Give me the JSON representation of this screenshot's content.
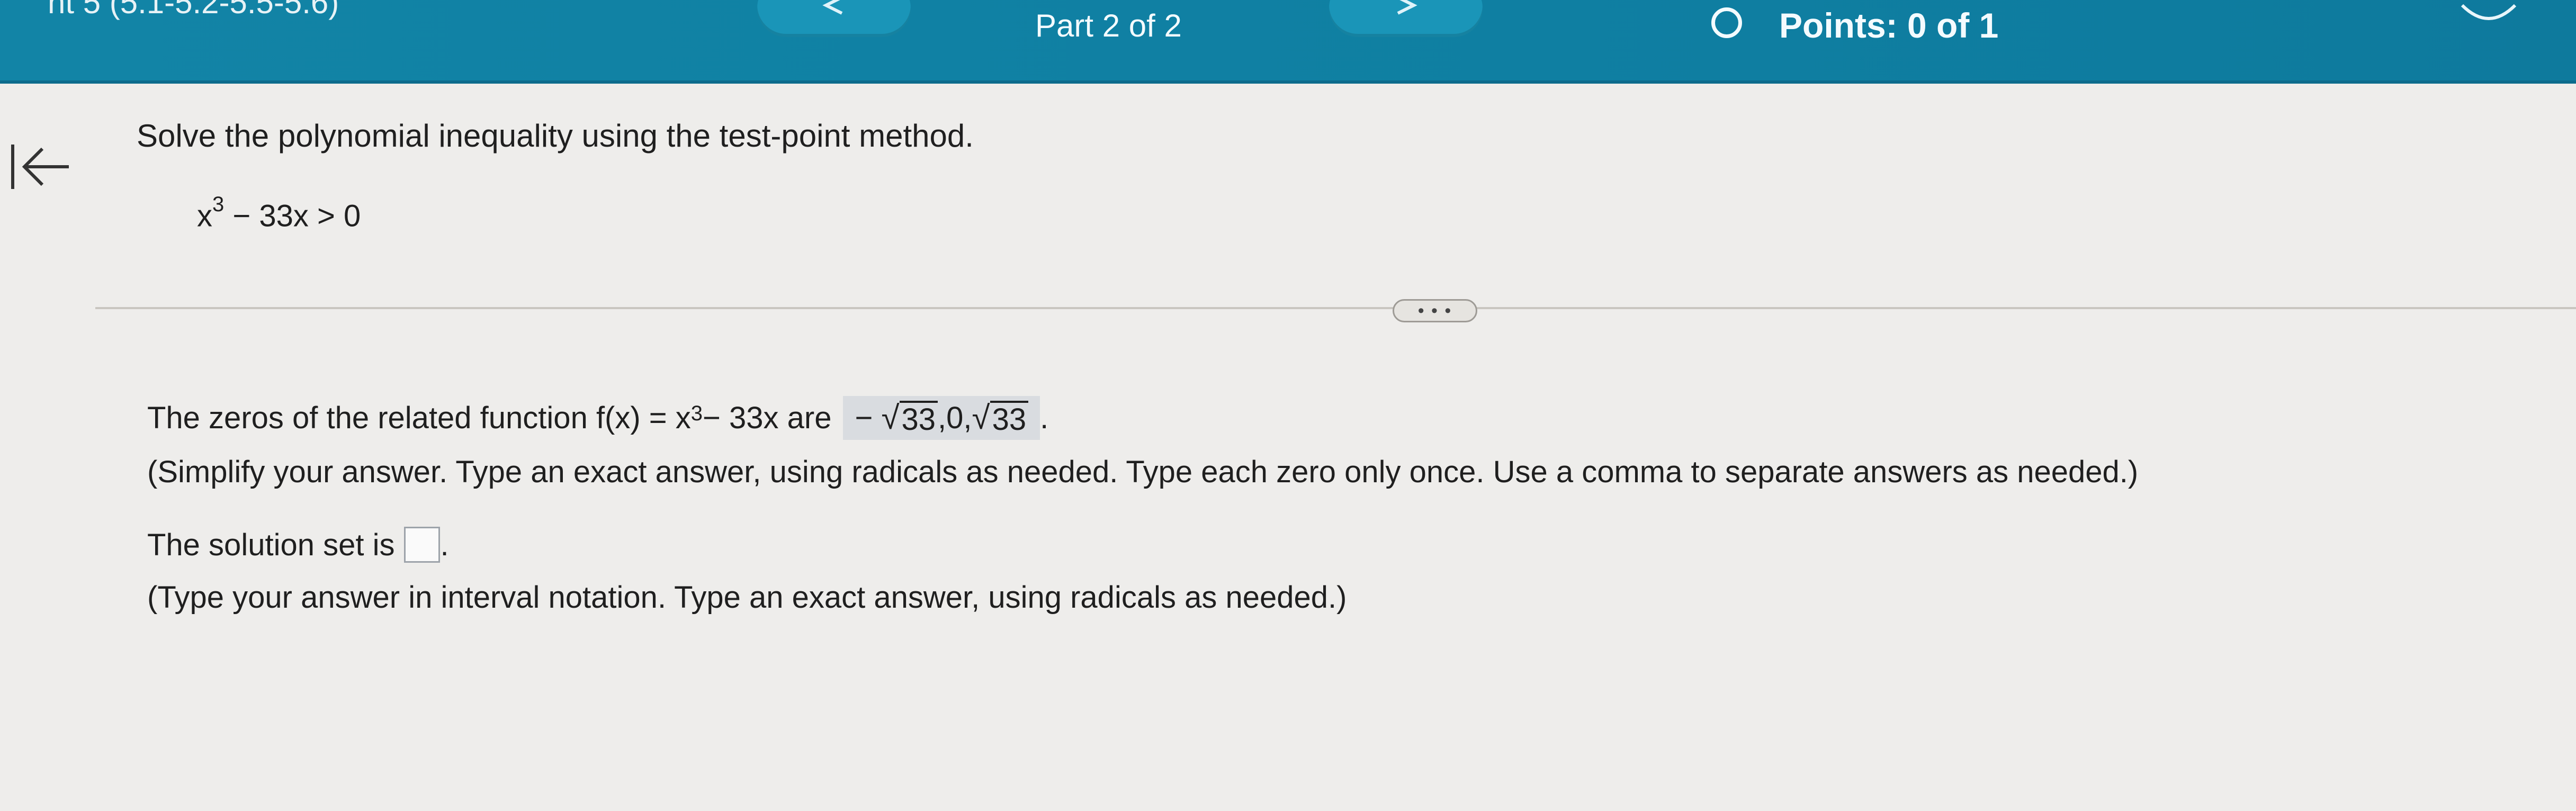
{
  "header": {
    "cut_title": "nt 5 (5.1-5.2-5.5-5.6)",
    "part": "Part 2 of 2",
    "points": "Points: 0 of 1"
  },
  "question": {
    "instruction": "Solve the polynomial inequality using the test-point method.",
    "base": "x",
    "exp": "3",
    "rest": " − 33x > 0"
  },
  "more_label": "• • •",
  "zeros": {
    "prefix": "The zeros of the related function f(x) = x",
    "exp": "3",
    "suffix": " − 33x are",
    "answer_neg": "−",
    "radicand": "33",
    "middle": ",0,",
    "period": ".",
    "hint": "(Simplify your answer. Type an exact answer, using radicals as needed. Type each zero only once. Use a comma to separate answers as needed.)"
  },
  "solution": {
    "label": "The solution set is",
    "period": ".",
    "value": "",
    "hint": "(Type your answer in interval notation. Type an exact answer, using radicals as needed.)"
  },
  "colors": {
    "header": "#1284a6",
    "background": "#eeedeb",
    "answer_box": "#d9dce0"
  }
}
